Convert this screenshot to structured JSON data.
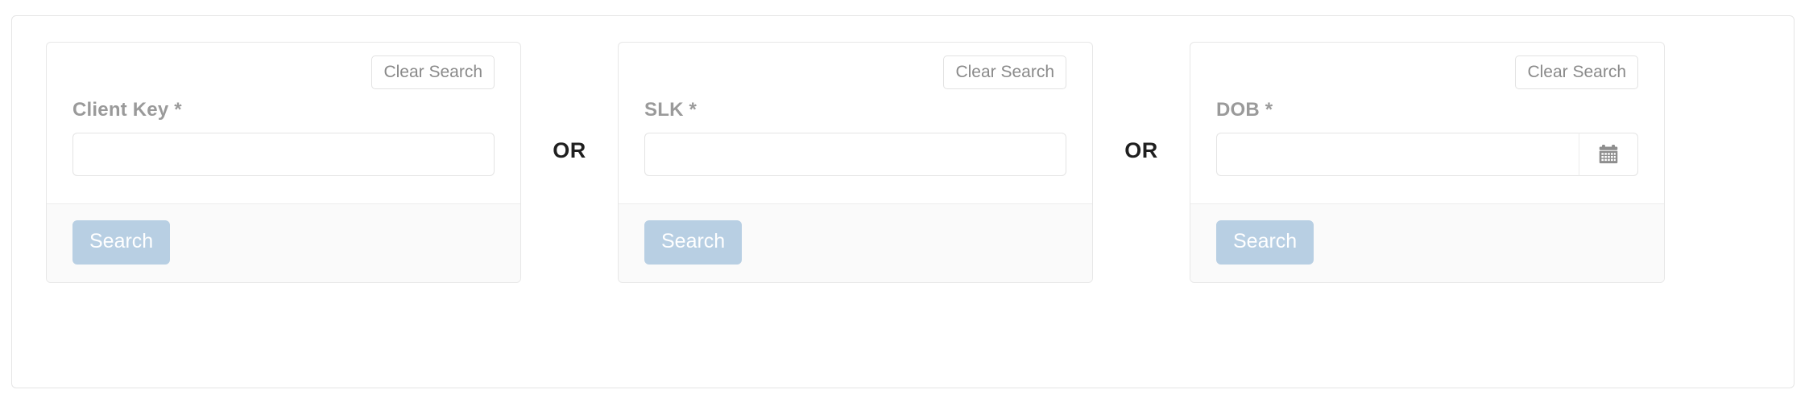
{
  "colors": {
    "page_background": "#ffffff",
    "outer_border": "#e5e5e5",
    "card_border": "#e7e7e7",
    "card_footer_background": "#fafafa",
    "search_button_background": "#b8cfe3",
    "search_button_text": "#ffffff",
    "clear_button_text": "#8a8a8a",
    "label_text": "#9a9a9a",
    "or_text": "#1f1f1f",
    "input_border": "#e4e4e4",
    "calendar_icon": "#8e8e8e"
  },
  "separators": {
    "or_label": "OR"
  },
  "panels": [
    {
      "id": "client-key",
      "clear_label": "Clear Search",
      "field_label": "Client Key *",
      "input_value": "",
      "input_placeholder": "",
      "has_calendar": false,
      "calendar_icon": "",
      "search_label": "Search"
    },
    {
      "id": "slk",
      "clear_label": "Clear Search",
      "field_label": "SLK *",
      "input_value": "",
      "input_placeholder": "",
      "has_calendar": false,
      "calendar_icon": "",
      "search_label": "Search"
    },
    {
      "id": "dob",
      "clear_label": "Clear Search",
      "field_label": "DOB *",
      "input_value": "",
      "input_placeholder": "",
      "has_calendar": true,
      "calendar_icon": "calendar-icon",
      "search_label": "Search"
    }
  ]
}
